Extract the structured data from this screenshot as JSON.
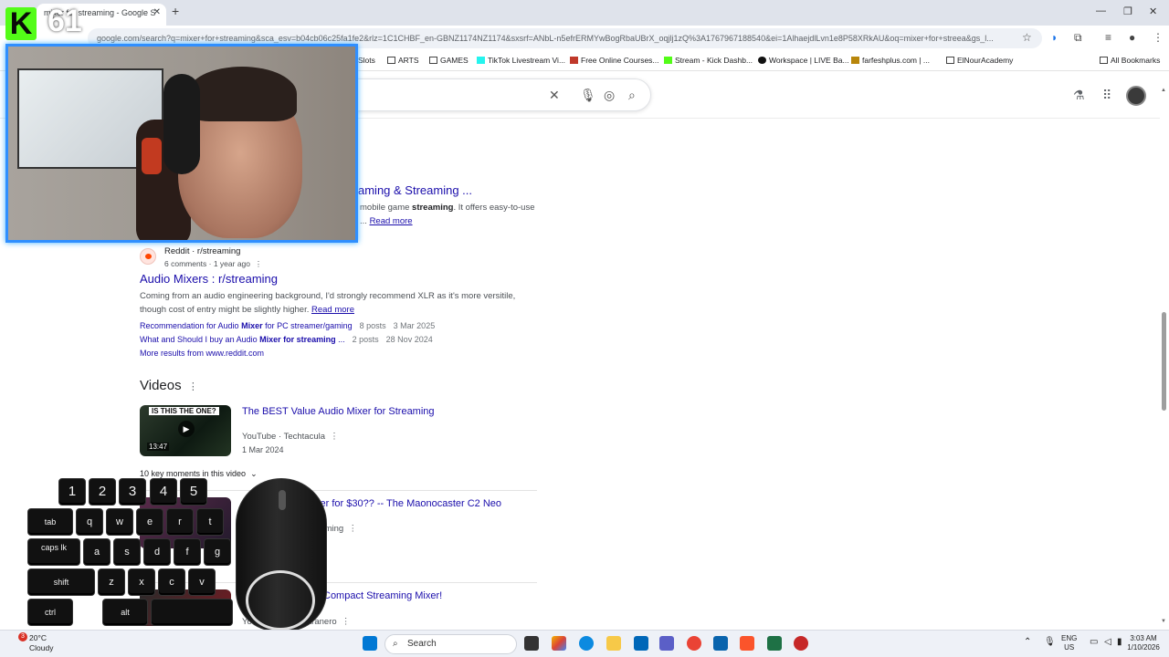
{
  "browser": {
    "tab_title": "mixer for streaming - Google S",
    "tab_close": "✕",
    "new_tab": "+",
    "url": "google.com/search?q=mixer+for+streaming&sca_esv=b04cb06c25fa1fe2&rlz=1C1CHBF_en-GBNZ1174NZ1174&sxsrf=ANbL-n5efrERMYwBogRbaUBrX_oqjlj1zQ%3A1767967188540&ei=1AlhaejdlLvn1e8P58XRkAU&oq=mixer+for+streea&gs_l...",
    "bookmarks": [
      {
        "label": "Slots",
        "icon": "folder-icon"
      },
      {
        "label": "ARTS",
        "icon": "folder-icon"
      },
      {
        "label": "GAMES",
        "icon": "folder-icon"
      },
      {
        "label": "TikTok Livestream Vi...",
        "icon": "tiktok-icon"
      },
      {
        "label": "Free Online Courses...",
        "icon": "courses-icon"
      },
      {
        "label": "Stream - Kick Dashb...",
        "icon": "kick-icon"
      },
      {
        "label": "Workspace | LIVE Ba...",
        "icon": "tiktok-icon"
      },
      {
        "label": "farfeshplus.com | ...",
        "icon": "site-icon"
      },
      {
        "label": "ElNourAcademy",
        "icon": "folder-icon"
      }
    ],
    "all_bookmarks": "All Bookmarks"
  },
  "search": {
    "clear_icon": "✕"
  },
  "results": {
    "partial_title": "aming & Streaming ...",
    "partial_snippet": "mobile game streaming. It offers easy-to-use",
    "partial_snippet_prefix": "mobile game ",
    "partial_snippet_bold": "streaming",
    "partial_snippet_suffix": ". It offers easy-to-use",
    "partial_read_more_prefix": "...",
    "read_more": "Read more",
    "reddit": {
      "source": "Reddit",
      "sub": "r/streaming",
      "meta": "6 comments · 1 year ago",
      "title": "Audio Mixers : r/streaming",
      "snippet_line1": "Coming from an audio engineering background, I'd strongly recommend XLR as it's more versitile,",
      "snippet_line2": "though cost of entry might be slightly higher.",
      "sublink1_pre": "Recommendation for Audio ",
      "sublink1_bold": "Mixer",
      "sublink1_post": " for PC streamer/gaming",
      "sublink1_posts": "8 posts",
      "sublink1_date": "3 Mar 2025",
      "sublink2_pre": "What and Should I buy an Audio ",
      "sublink2_bold": "Mixer for streaming",
      "sublink2_post": " ...",
      "sublink2_posts": "2 posts",
      "sublink2_date": "28 Nov 2024",
      "more": "More results from www.reddit.com"
    },
    "videos_heading": "Videos",
    "video1": {
      "banner": "IS THIS THE ONE?",
      "duration": "13:47",
      "title": "The BEST Value Audio Mixer for Streaming",
      "source": "YouTube · Techtacula",
      "date": "1 Mar 2024",
      "key_moments": "10 key moments in this video"
    },
    "video2": {
      "title_partial": "xer for $30?? -- The Maonocaster C2 Neo",
      "source_partial": "eaming"
    },
    "video3": {
      "title_partial": "Compact Streaming Mixer!",
      "source_partial": "You",
      "source_partial2": "Haranero"
    }
  },
  "overlay": {
    "counter": "61",
    "logo": "K",
    "keys_row1": [
      "1",
      "2",
      "3",
      "4",
      "5"
    ],
    "keys_row2": [
      "tab",
      "q",
      "w",
      "e",
      "r",
      "t"
    ],
    "keys_row3": [
      "caps lk",
      "a",
      "s",
      "d",
      "f",
      "g"
    ],
    "keys_row4": [
      "shift",
      "z",
      "x",
      "c",
      "v"
    ],
    "keys_row5": [
      "ctrl",
      "alt"
    ]
  },
  "taskbar": {
    "weather_temp": "20°C",
    "weather_desc": "Cloudy",
    "weather_badge": "3",
    "search": "Search",
    "lang1": "ENG",
    "lang2": "US",
    "time": "3:03 AM",
    "date": "1/10/2026"
  },
  "colors": {
    "link": "#1a0dab",
    "kick_green": "#53fc18",
    "cam_border": "#2f8fff"
  }
}
